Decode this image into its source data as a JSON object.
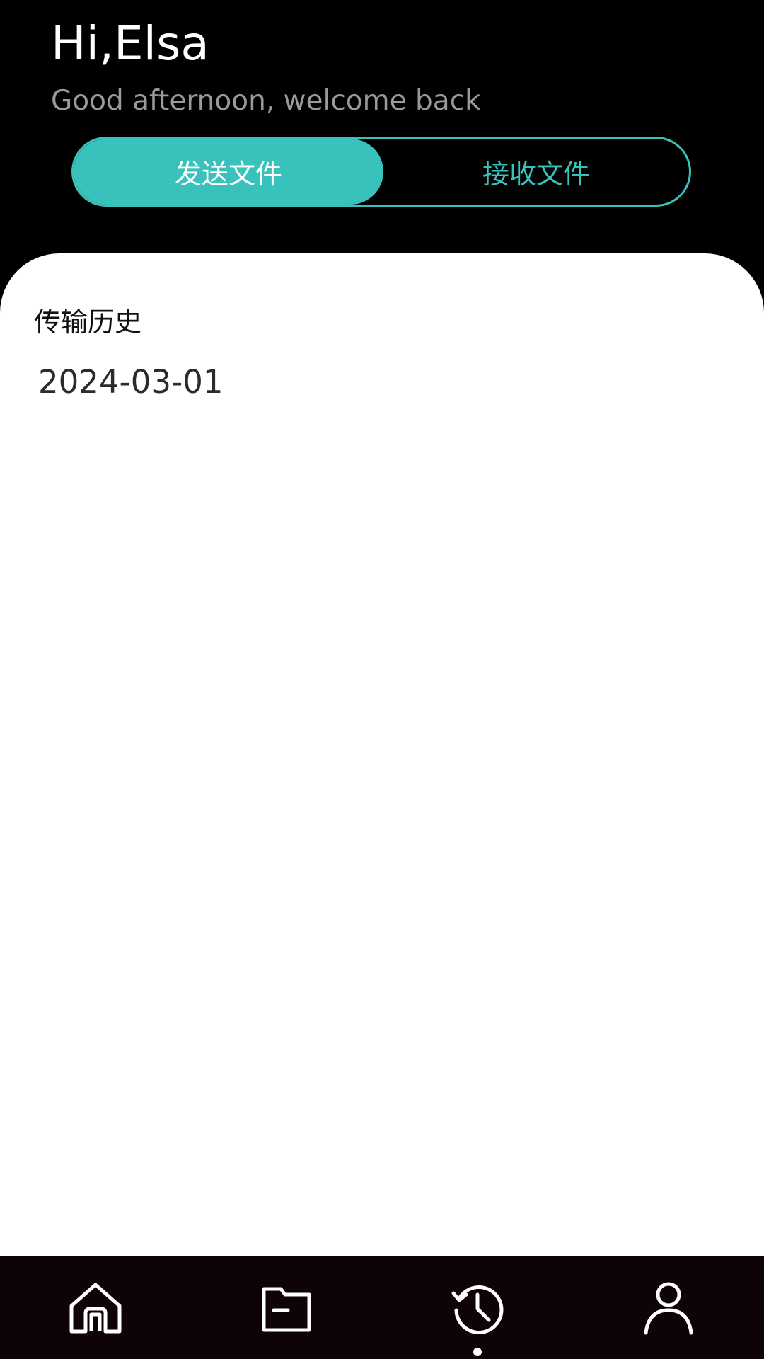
{
  "header": {
    "greeting": "Hi,Elsa",
    "subtitle": "Good afternoon, welcome back"
  },
  "segment": {
    "send_label": "发送文件",
    "receive_label": "接收文件",
    "selected": "send",
    "accent_color": "#39c2bc"
  },
  "history": {
    "title": "传输历史",
    "groups": [
      {
        "date": "2024-03-01"
      }
    ]
  },
  "tabbar": {
    "items": [
      {
        "icon": "home-icon",
        "active": false
      },
      {
        "icon": "folder-icon",
        "active": false
      },
      {
        "icon": "history-icon",
        "active": true
      },
      {
        "icon": "user-icon",
        "active": false
      }
    ]
  }
}
